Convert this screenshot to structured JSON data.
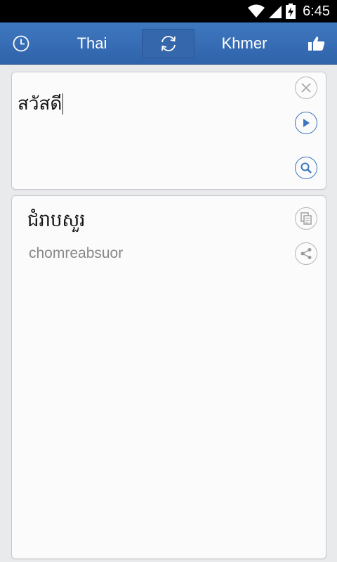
{
  "status_bar": {
    "time": "6:45"
  },
  "app_bar": {
    "source_language": "Thai",
    "target_language": "Khmer",
    "accent_color": "#3a70b8"
  },
  "input": {
    "text": "สวัสดี"
  },
  "output": {
    "translation": "ជំរាបសួរ",
    "transliteration": "chomreabsuor"
  }
}
